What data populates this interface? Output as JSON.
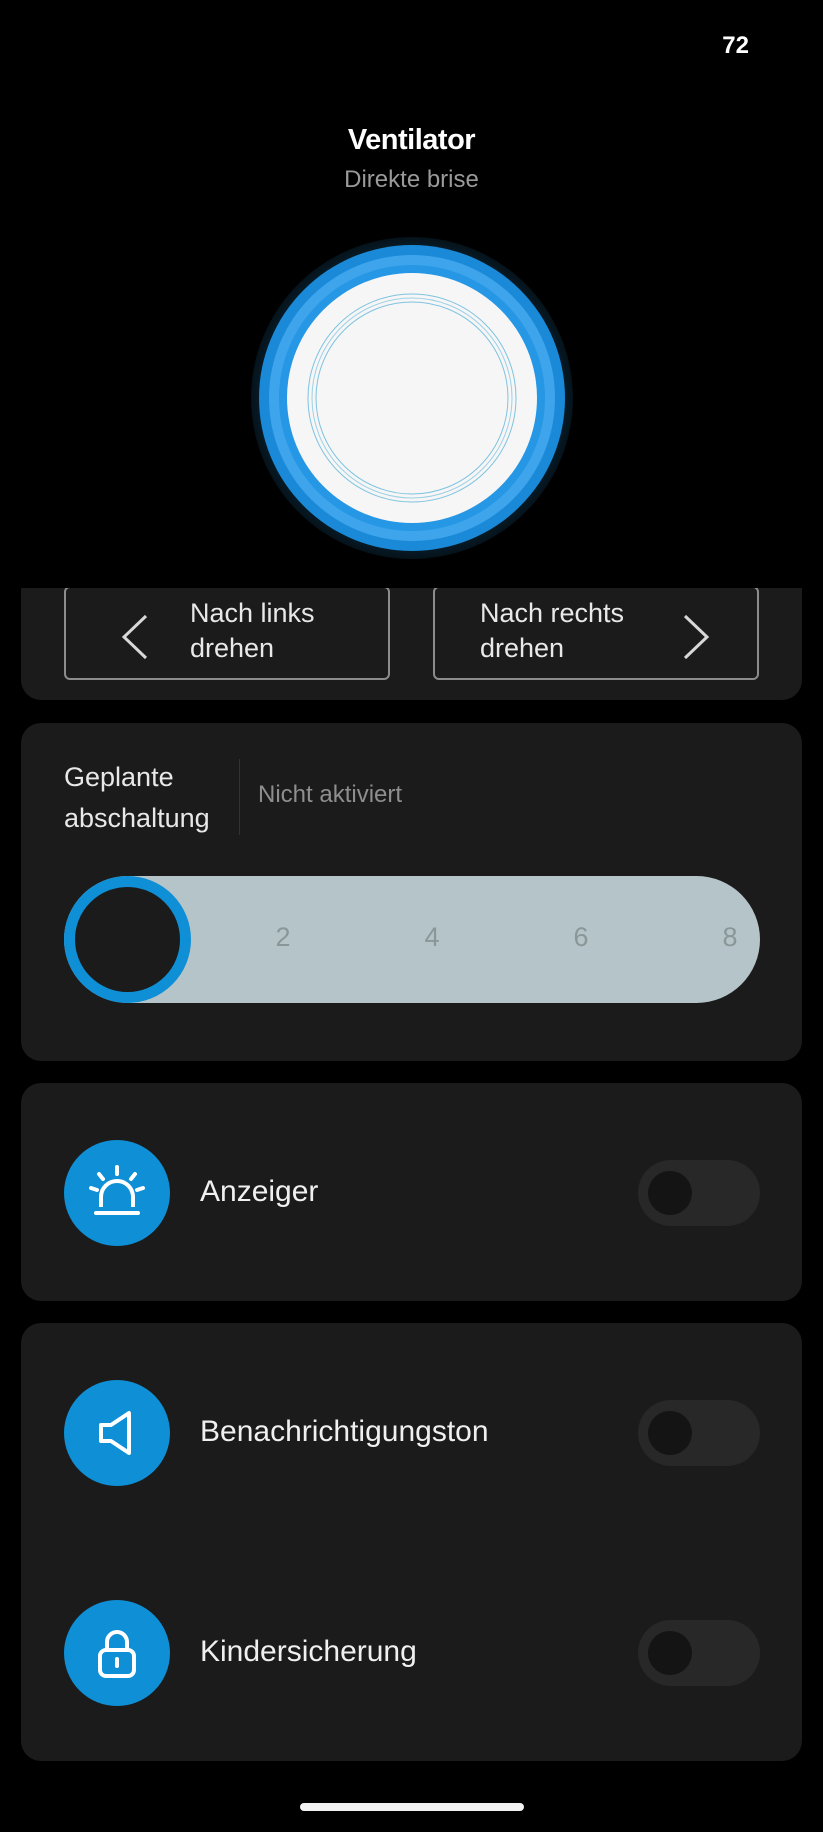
{
  "status": {
    "number": "72"
  },
  "header": {
    "title": "Ventilator",
    "subtitle": "Direkte brise"
  },
  "rotation": {
    "left_label_1": "Nach links",
    "left_label_2": "drehen",
    "right_label_1": "Nach rechts",
    "right_label_2": "drehen"
  },
  "timer": {
    "label_1": "Geplante",
    "label_2": "abschaltung",
    "status": "Nicht aktiviert",
    "ticks": [
      "2",
      "4",
      "6",
      "8"
    ]
  },
  "indicator": {
    "label": "Anzeiger",
    "enabled": false
  },
  "sound": {
    "label": "Benachrichtigungston",
    "enabled": false
  },
  "child_lock": {
    "label": "Kindersicherung",
    "enabled": false
  },
  "colors": {
    "accent": "#0e8fd6",
    "card": "#1b1b1b",
    "track": "#b5c4c8"
  }
}
